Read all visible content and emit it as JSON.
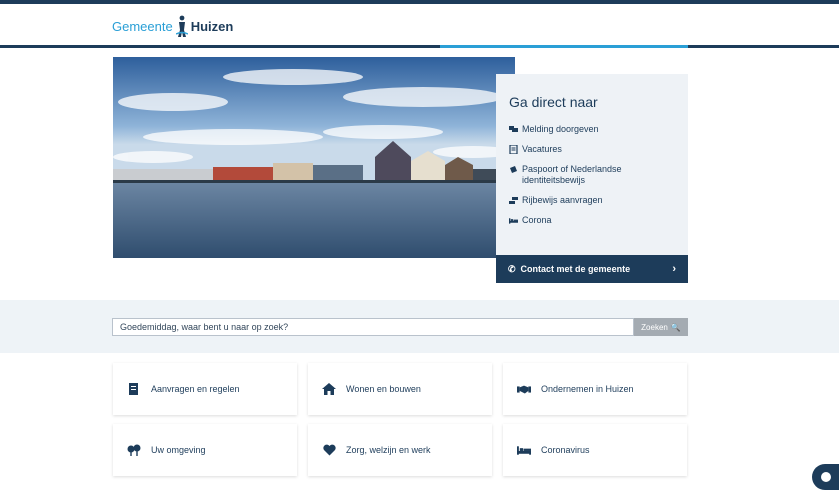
{
  "header": {
    "logo_part1": "Gemeente",
    "logo_part2": "Huizen"
  },
  "quicklinks": {
    "title": "Ga direct naar",
    "items": [
      {
        "label": "Melding doorgeven",
        "icon": "comments-icon"
      },
      {
        "label": "Vacatures",
        "icon": "document-icon"
      },
      {
        "label": "Paspoort of Nederlandse identiteitsbewijs",
        "icon": "passport-icon"
      },
      {
        "label": "Rijbewijs aanvragen",
        "icon": "car-icon"
      },
      {
        "label": "Corona",
        "icon": "bed-icon"
      }
    ],
    "contact_label": "Contact met de gemeente"
  },
  "search": {
    "placeholder": "Goedemiddag, waar bent u naar op zoek?",
    "button_label": "Zoeken"
  },
  "tiles": [
    {
      "label": "Aanvragen en regelen",
      "icon": "form-icon"
    },
    {
      "label": "Wonen en bouwen",
      "icon": "house-icon"
    },
    {
      "label": "Ondernemen in Huizen",
      "icon": "handshake-icon"
    },
    {
      "label": "Uw omgeving",
      "icon": "trees-icon"
    },
    {
      "label": "Zorg, welzijn en werk",
      "icon": "heart-icon"
    },
    {
      "label": "Coronavirus",
      "icon": "bed-icon"
    }
  ],
  "colors": {
    "primary": "#1d3c5a",
    "accent": "#2a9fd6",
    "panel": "#eef2f6"
  }
}
